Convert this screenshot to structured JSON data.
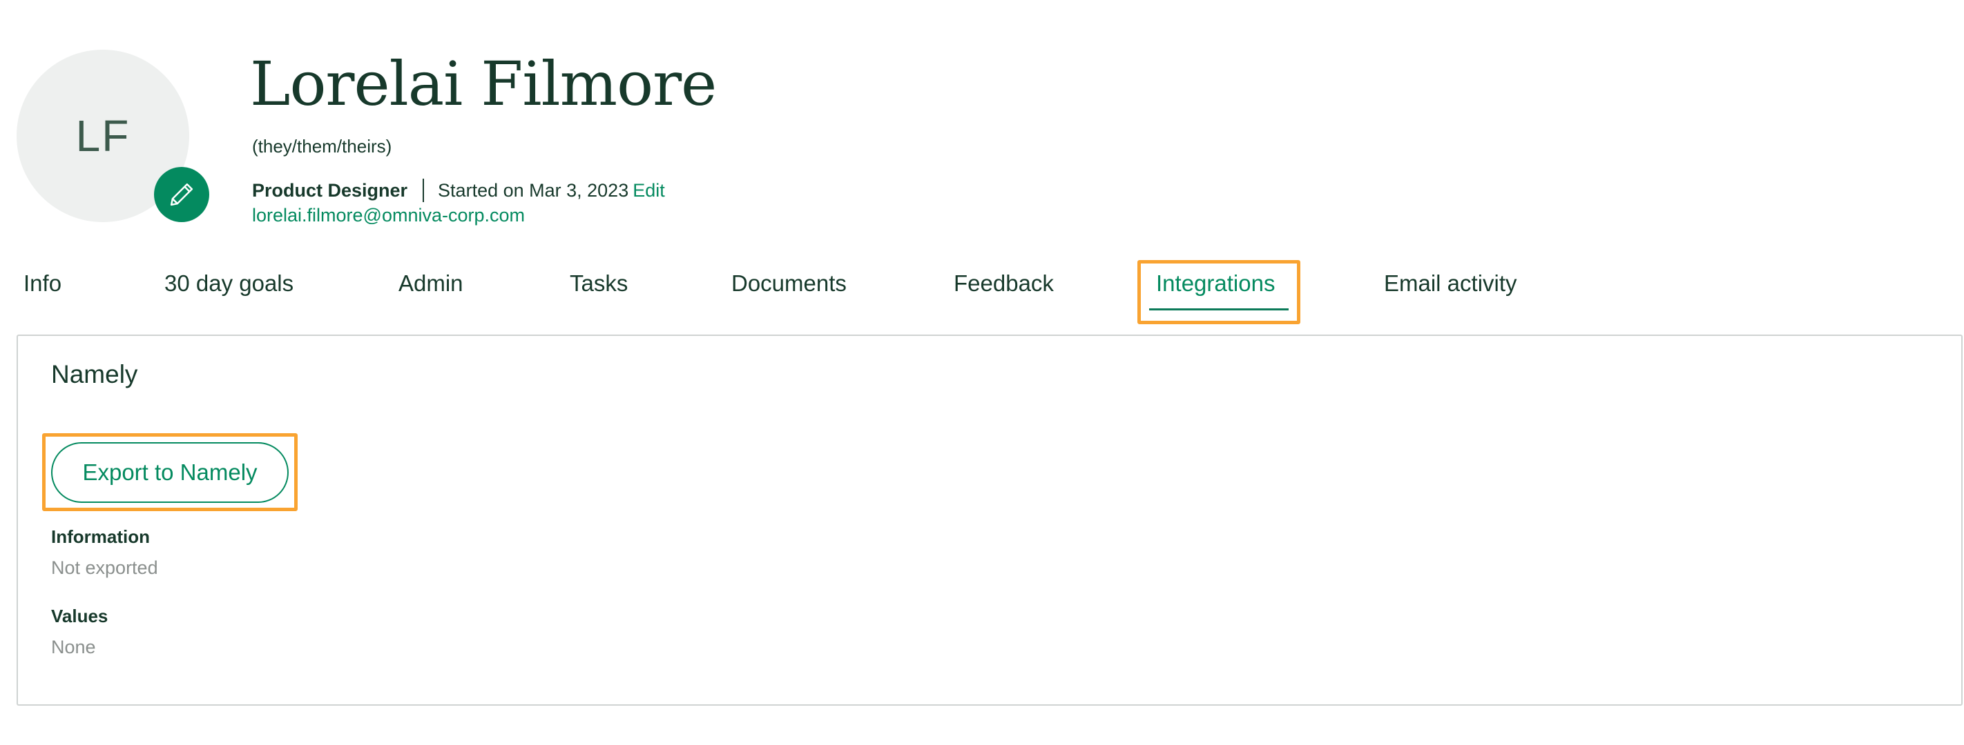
{
  "profile": {
    "initials": "LF",
    "name": "Lorelai Filmore",
    "pronouns": "(they/them/theirs)",
    "job_title": "Product Designer",
    "start_date": "Started on Mar 3, 2023",
    "edit_label": "Edit",
    "email": "lorelai.filmore@omniva-corp.com",
    "edit_avatar_icon": "pencil-icon"
  },
  "tabs": [
    {
      "label": "Info",
      "active": false
    },
    {
      "label": "30 day goals",
      "active": false
    },
    {
      "label": "Admin",
      "active": false
    },
    {
      "label": "Tasks",
      "active": false
    },
    {
      "label": "Documents",
      "active": false
    },
    {
      "label": "Feedback",
      "active": false
    },
    {
      "label": "Integrations",
      "active": true
    },
    {
      "label": "Email activity",
      "active": false
    }
  ],
  "integration": {
    "title": "Namely",
    "export_button": "Export to Namely",
    "fields": [
      {
        "label": "Information",
        "value": "Not exported"
      },
      {
        "label": "Values",
        "value": "None"
      }
    ]
  },
  "colors": {
    "brand_green": "#048a5f",
    "text_dark": "#17392b",
    "muted": "#8a8f8d",
    "highlight": "#f9a331"
  }
}
